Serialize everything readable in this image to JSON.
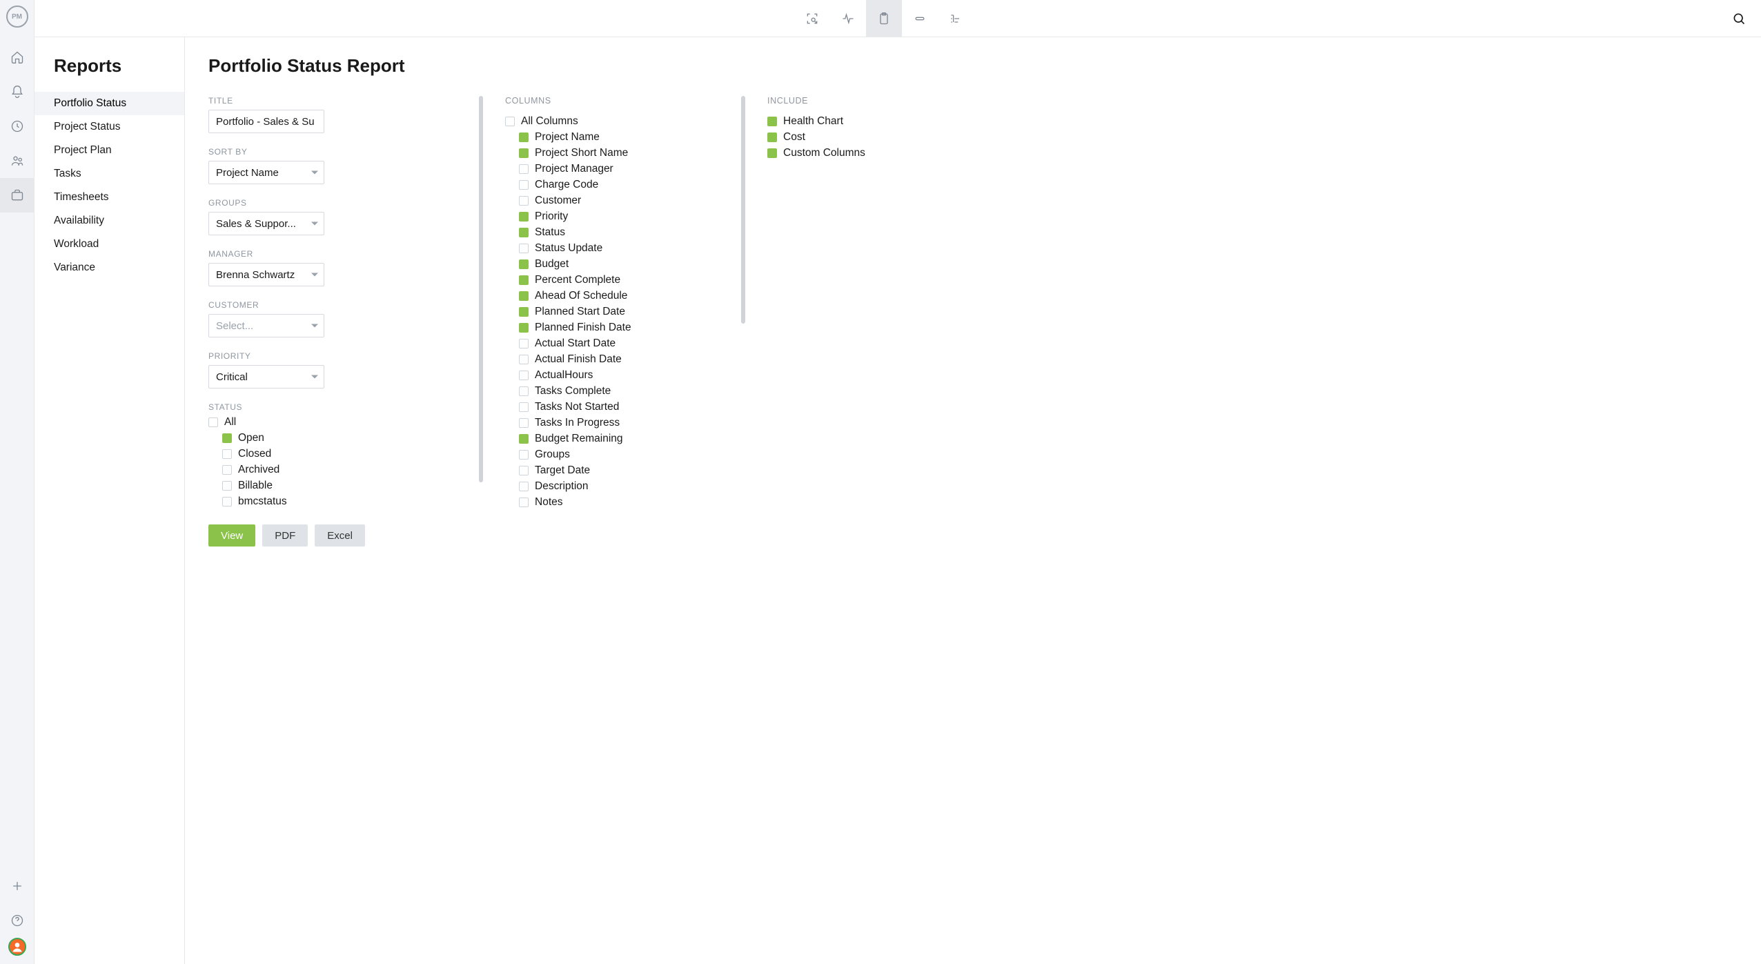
{
  "logo_text": "PM",
  "sidebar": {
    "heading": "Reports",
    "items": [
      "Portfolio Status",
      "Project Status",
      "Project Plan",
      "Tasks",
      "Timesheets",
      "Availability",
      "Workload",
      "Variance"
    ],
    "active_index": 0
  },
  "page_title": "Portfolio Status Report",
  "filters": {
    "title_label": "TITLE",
    "title_value": "Portfolio - Sales & Su",
    "sortby_label": "SORT BY",
    "sortby_value": "Project Name",
    "groups_label": "GROUPS",
    "groups_value": "Sales & Suppor...",
    "manager_label": "MANAGER",
    "manager_value": "Brenna Schwartz",
    "customer_label": "CUSTOMER",
    "customer_placeholder": "Select...",
    "priority_label": "PRIORITY",
    "priority_value": "Critical",
    "status_label": "STATUS",
    "status_items": [
      {
        "label": "All",
        "checked": false
      },
      {
        "label": "Open",
        "checked": true,
        "indent": true
      },
      {
        "label": "Closed",
        "checked": false,
        "indent": true
      },
      {
        "label": "Archived",
        "checked": false,
        "indent": true
      },
      {
        "label": "Billable",
        "checked": false,
        "indent": true
      },
      {
        "label": "bmcstatus",
        "checked": false,
        "indent": true
      }
    ]
  },
  "columns": {
    "label": "COLUMNS",
    "items": [
      {
        "label": "All Columns",
        "checked": false
      },
      {
        "label": "Project Name",
        "checked": true,
        "indent": true
      },
      {
        "label": "Project Short Name",
        "checked": true,
        "indent": true
      },
      {
        "label": "Project Manager",
        "checked": false,
        "indent": true
      },
      {
        "label": "Charge Code",
        "checked": false,
        "indent": true
      },
      {
        "label": "Customer",
        "checked": false,
        "indent": true
      },
      {
        "label": "Priority",
        "checked": true,
        "indent": true
      },
      {
        "label": "Status",
        "checked": true,
        "indent": true
      },
      {
        "label": "Status Update",
        "checked": false,
        "indent": true
      },
      {
        "label": "Budget",
        "checked": true,
        "indent": true
      },
      {
        "label": "Percent Complete",
        "checked": true,
        "indent": true
      },
      {
        "label": "Ahead Of Schedule",
        "checked": true,
        "indent": true
      },
      {
        "label": "Planned Start Date",
        "checked": true,
        "indent": true
      },
      {
        "label": "Planned Finish Date",
        "checked": true,
        "indent": true
      },
      {
        "label": "Actual Start Date",
        "checked": false,
        "indent": true
      },
      {
        "label": "Actual Finish Date",
        "checked": false,
        "indent": true
      },
      {
        "label": "ActualHours",
        "checked": false,
        "indent": true
      },
      {
        "label": "Tasks Complete",
        "checked": false,
        "indent": true
      },
      {
        "label": "Tasks Not Started",
        "checked": false,
        "indent": true
      },
      {
        "label": "Tasks In Progress",
        "checked": false,
        "indent": true
      },
      {
        "label": "Budget Remaining",
        "checked": true,
        "indent": true
      },
      {
        "label": "Groups",
        "checked": false,
        "indent": true
      },
      {
        "label": "Target Date",
        "checked": false,
        "indent": true
      },
      {
        "label": "Description",
        "checked": false,
        "indent": true
      },
      {
        "label": "Notes",
        "checked": false,
        "indent": true
      }
    ]
  },
  "include": {
    "label": "INCLUDE",
    "items": [
      {
        "label": "Health Chart",
        "checked": true
      },
      {
        "label": "Cost",
        "checked": true
      },
      {
        "label": "Custom Columns",
        "checked": true
      }
    ]
  },
  "buttons": {
    "view": "View",
    "pdf": "PDF",
    "excel": "Excel"
  }
}
